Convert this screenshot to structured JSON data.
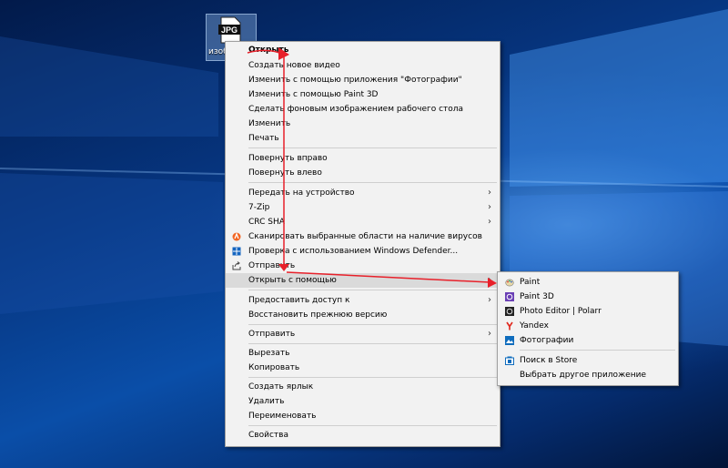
{
  "desktop": {
    "file_badge": "JPG",
    "file_name": "изобр"
  },
  "context_menu": {
    "items": [
      {
        "label": "Открыть"
      },
      {
        "label": "Создать новое видео"
      },
      {
        "label": "Изменить с помощью приложения \"Фотографии\""
      },
      {
        "label": "Изменить с помощью Paint 3D"
      },
      {
        "label": "Сделать фоновым изображением рабочего стола"
      },
      {
        "label": "Изменить"
      },
      {
        "label": "Печать"
      },
      {
        "label": "Повернуть вправо"
      },
      {
        "label": "Повернуть влево"
      },
      {
        "label": "Передать на устройство",
        "arrow": "›"
      },
      {
        "label": "7-Zip",
        "arrow": "›"
      },
      {
        "label": "CRC SHA",
        "arrow": "›"
      },
      {
        "label": "Сканировать выбранные области на наличие вирусов"
      },
      {
        "label": "Проверка с использованием Windows Defender..."
      },
      {
        "label": "Отправить"
      },
      {
        "label": "Открыть с помощью",
        "arrow": "›"
      },
      {
        "label": "Предоставить доступ к",
        "arrow": "›"
      },
      {
        "label": "Восстановить прежнюю версию"
      },
      {
        "label": "Отправить",
        "arrow": "›"
      },
      {
        "label": "Вырезать"
      },
      {
        "label": "Копировать"
      },
      {
        "label": "Создать ярлык"
      },
      {
        "label": "Удалить"
      },
      {
        "label": "Переименовать"
      },
      {
        "label": "Свойства"
      }
    ]
  },
  "submenu": {
    "items": [
      {
        "label": "Paint"
      },
      {
        "label": "Paint 3D"
      },
      {
        "label": "Photo Editor | Polarr"
      },
      {
        "label": "Yandex"
      },
      {
        "label": "Фотографии"
      },
      {
        "label": "Поиск в Store"
      },
      {
        "label": "Выбрать другое приложение"
      }
    ]
  },
  "colors": {
    "annotation": "#e8202a",
    "menu_bg": "#f2f2f2",
    "highlight": "#dadada"
  }
}
